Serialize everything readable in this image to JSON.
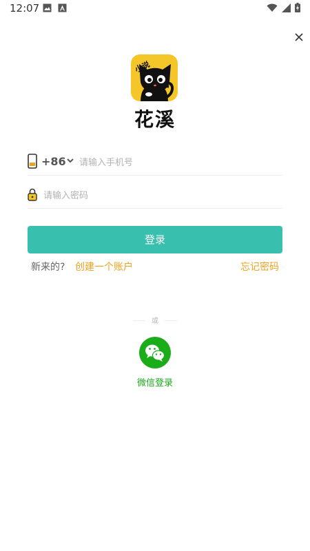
{
  "status_bar": {
    "time": "12:07"
  },
  "icons": {
    "close": "close-icon",
    "phone": "phone-icon",
    "lock": "lock-icon",
    "chevron": "chevron-down-icon",
    "wechat": "wechat-icon"
  },
  "brand": {
    "app_name": "花溪",
    "logo_badge_text": "小说"
  },
  "login_form": {
    "country_code": "+86",
    "phone_placeholder": "请输入手机号",
    "phone_value": "",
    "password_placeholder": "请输入密码",
    "password_value": "",
    "login_button_label": "登录"
  },
  "links": {
    "new_user_prompt": "新来的?",
    "create_account": "创建一个账户",
    "forgot_password": "忘记密码"
  },
  "alt_login": {
    "divider_text": "或",
    "wechat_label": "微信登录"
  },
  "colors": {
    "accent": "#38bfae",
    "link": "#f0a21e",
    "wechat_green": "#1aad19",
    "logo_yellow": "#f5c62a"
  }
}
